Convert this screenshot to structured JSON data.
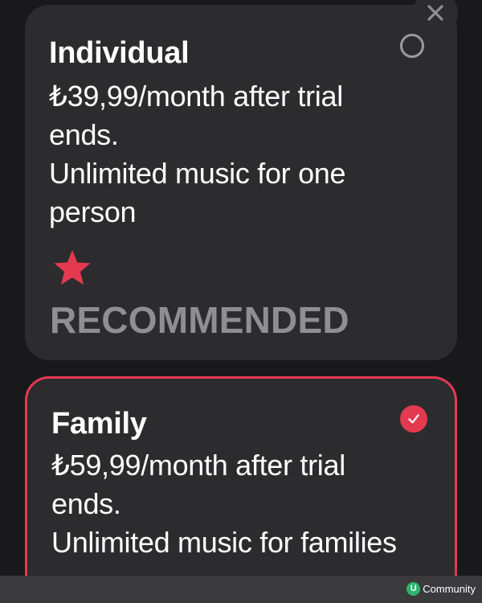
{
  "controls": {
    "close_icon": "close-icon"
  },
  "plans": [
    {
      "name": "Individual",
      "price_line": "₺39,99/month after trial ends.",
      "description": "Unlimited music for one person",
      "badge": "RECOMMENDED",
      "badge_icon": "star-icon",
      "selected": false
    },
    {
      "name": "Family",
      "price_line": "₺59,99/month after trial ends.",
      "description": "Unlimited music for families",
      "selected": true
    }
  ],
  "watermark": {
    "logo_letter": "U",
    "label": "Community"
  },
  "colors": {
    "accent": "#e33a50",
    "card_background": "#2c2c2e",
    "page_background": "#19191b",
    "muted_text": "#8e8e93",
    "watermark_logo": "#2fb36b"
  }
}
